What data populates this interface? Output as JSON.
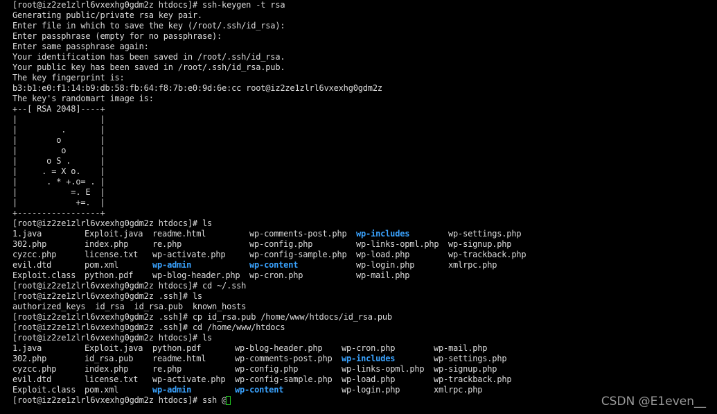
{
  "terminal": {
    "session_1": [
      "[root@iz2ze1zlrl6vxexhg0gdm2z htdocs]# ssh-keygen -t rsa",
      "Generating public/private rsa key pair.",
      "Enter file in which to save the key (/root/.ssh/id_rsa):",
      "Enter passphrase (empty for no passphrase):",
      "Enter same passphrase again:",
      "Your identification has been saved in /root/.ssh/id_rsa.",
      "Your public key has been saved in /root/.ssh/id_rsa.pub.",
      "The key fingerprint is:",
      "b3:b1:e0:f1:14:b9:db:58:fb:64:f8:7b:e0:9d:6e:cc root@iz2ze1zlrl6vxexhg0gdm2z",
      "The key's randomart image is:",
      "+--[ RSA 2048]----+",
      "|                 |",
      "|         .       |",
      "|        o        |",
      "|         o       |",
      "|      o S .      |",
      "|     . = X o.    |",
      "|      . * +.o= . |",
      "|           =. E  |",
      "|            +=.  |",
      "+-----------------+",
      "[root@iz2ze1zlrl6vxexhg0gdm2z htdocs]# ls"
    ],
    "ls_1": [
      [
        "1.java",
        "Exploit.java",
        "readme.html",
        "wp-comments-post.php",
        "wp-includes",
        "wp-settings.php"
      ],
      [
        "302.php",
        "index.php",
        "re.php",
        "wp-config.php",
        "wp-links-opml.php",
        "wp-signup.php"
      ],
      [
        "cyzcc.php",
        "license.txt",
        "wp-activate.php",
        "wp-config-sample.php",
        "wp-load.php",
        "wp-trackback.php"
      ],
      [
        "evil.dtd",
        "pom.xml",
        "wp-admin",
        "wp-content",
        "wp-login.php",
        "xmlrpc.php"
      ],
      [
        "Exploit.class",
        "python.pdf",
        "wp-blog-header.php",
        "wp-cron.php",
        "wp-mail.php",
        ""
      ]
    ],
    "ls_1_dirs": [
      "wp-includes",
      "wp-admin",
      "wp-content"
    ],
    "session_2": [
      "[root@iz2ze1zlrl6vxexhg0gdm2z htdocs]# cd ~/.ssh",
      "[root@iz2ze1zlrl6vxexhg0gdm2z .ssh]# ls",
      "authorized_keys  id_rsa  id_rsa.pub  known_hosts",
      "[root@iz2ze1zlrl6vxexhg0gdm2z .ssh]# cp id_rsa.pub /home/www/htdocs/id_rsa.pub",
      "[root@iz2ze1zlrl6vxexhg0gdm2z .ssh]# cd /home/www/htdocs",
      "[root@iz2ze1zlrl6vxexhg0gdm2z htdocs]# ls"
    ],
    "ls_2": [
      [
        "1.java",
        "Exploit.java",
        "python.pdf",
        "wp-blog-header.php",
        "wp-cron.php",
        "wp-mail.php"
      ],
      [
        "302.php",
        "id_rsa.pub",
        "readme.html",
        "wp-comments-post.php",
        "wp-includes",
        "wp-settings.php"
      ],
      [
        "cyzcc.php",
        "index.php",
        "re.php",
        "wp-config.php",
        "wp-links-opml.php",
        "wp-signup.php"
      ],
      [
        "evil.dtd",
        "license.txt",
        "wp-activate.php",
        "wp-config-sample.php",
        "wp-load.php",
        "wp-trackback.php"
      ],
      [
        "Exploit.class",
        "pom.xml",
        "wp-admin",
        "wp-content",
        "wp-login.php",
        "xmlrpc.php"
      ]
    ],
    "ls_2_dirs": [
      "wp-includes",
      "wp-admin",
      "wp-content"
    ],
    "prompt_current": "[root@iz2ze1zlrl6vxexhg0gdm2z htdocs]# ssh @",
    "colors": {
      "background": "#000000",
      "text": "#dcdcdc",
      "directory": "#3aa3ff",
      "cursor": "#22c922"
    }
  },
  "watermark": "CSDN @E1even__"
}
